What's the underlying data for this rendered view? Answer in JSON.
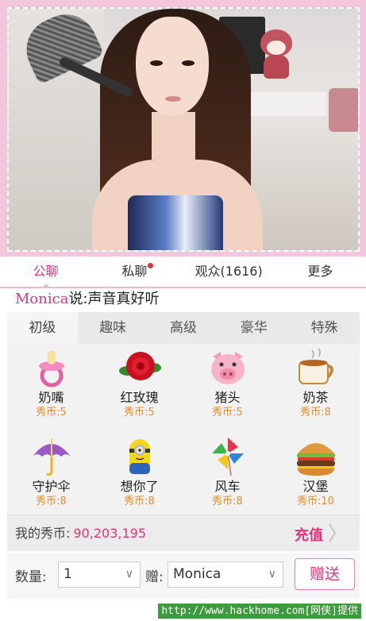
{
  "tabs": [
    {
      "label": "公聊",
      "active": true
    },
    {
      "label": "私聊",
      "has_dot": true
    },
    {
      "label": "观众(1616)"
    },
    {
      "label": "更多"
    }
  ],
  "chat": {
    "user": "Monica",
    "message": "说:声音真好听"
  },
  "gift_tabs": [
    {
      "label": "初级",
      "active": true
    },
    {
      "label": "趣味"
    },
    {
      "label": "高级"
    },
    {
      "label": "豪华"
    },
    {
      "label": "特殊"
    }
  ],
  "gifts": [
    {
      "name": "奶嘴",
      "price": "秀币:5",
      "icon": "pacifier-icon"
    },
    {
      "name": "红玫瑰",
      "price": "秀币:5",
      "icon": "red-rose-icon"
    },
    {
      "name": "猪头",
      "price": "秀币:5",
      "icon": "pig-head-icon"
    },
    {
      "name": "奶茶",
      "price": "秀币:8",
      "icon": "milk-tea-icon"
    },
    {
      "name": "守护伞",
      "price": "秀币:8",
      "icon": "umbrella-icon"
    },
    {
      "name": "想你了",
      "price": "秀币:8",
      "icon": "minion-icon"
    },
    {
      "name": "风车",
      "price": "秀币:8",
      "icon": "pinwheel-icon"
    },
    {
      "name": "汉堡",
      "price": "秀币:10",
      "icon": "hamburger-icon"
    }
  ],
  "balance": {
    "label": "我的秀币:",
    "value": "90,203,195",
    "recharge": "充值"
  },
  "send": {
    "qty_label": "数量:",
    "qty_value": "1",
    "to_label": "赠:",
    "to_value": "Monica",
    "button": "赠送"
  },
  "watermark": "http://www.hackhome.com[网侠]提供",
  "colors": {
    "accent": "#e7317b",
    "price": "#f08a2a",
    "frame": "#f4c6dc"
  }
}
